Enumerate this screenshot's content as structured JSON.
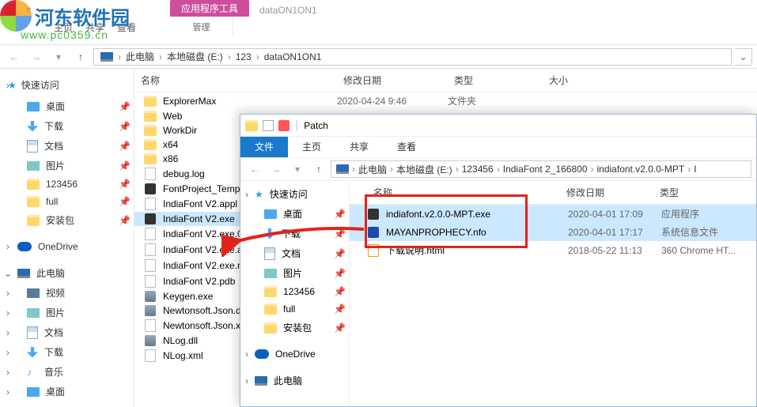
{
  "watermark": {
    "brand": "河东软件园",
    "url": "www.pc0359.cn"
  },
  "back_window": {
    "qat_icons": [
      "folder-icon",
      "props-icon",
      "new-folder-icon"
    ],
    "tabs": {
      "tools_header": "应用程序工具",
      "title": "dataON1ON1",
      "group_label": "管理",
      "left_labels": [
        "主页",
        "共享",
        "查看"
      ]
    },
    "breadcrumb": [
      "此电脑",
      "本地磁盘 (E:)",
      "123",
      "dataON1ON1"
    ],
    "columns": {
      "name": "名称",
      "date": "修改日期",
      "type": "类型",
      "size": "大小"
    },
    "sidebar": {
      "quick": "快速访问",
      "items": [
        {
          "label": "桌面",
          "icon": "desktop-icon",
          "pinned": true
        },
        {
          "label": "下载",
          "icon": "download-icon",
          "pinned": true
        },
        {
          "label": "文档",
          "icon": "document-icon",
          "pinned": true
        },
        {
          "label": "图片",
          "icon": "picture-icon",
          "pinned": true
        },
        {
          "label": "123456",
          "icon": "folder-icon",
          "pinned": true
        },
        {
          "label": "full",
          "icon": "folder-icon",
          "pinned": true
        },
        {
          "label": "安装包",
          "icon": "folder-icon",
          "pinned": true
        }
      ],
      "onedrive": "OneDrive",
      "thispc": "此电脑",
      "pc_items": [
        {
          "label": "视频",
          "icon": "video-icon"
        },
        {
          "label": "图片",
          "icon": "picture-icon"
        },
        {
          "label": "文档",
          "icon": "document-icon"
        },
        {
          "label": "下载",
          "icon": "download-icon"
        },
        {
          "label": "音乐",
          "icon": "music-icon"
        },
        {
          "label": "桌面",
          "icon": "desktop-icon"
        }
      ]
    },
    "files": [
      {
        "name": "ExplorerMax",
        "icon": "folder",
        "date": "2020-04-24 9:46",
        "type": "文件夹"
      },
      {
        "name": "Web",
        "icon": "folder"
      },
      {
        "name": "WorkDir",
        "icon": "folder"
      },
      {
        "name": "x64",
        "icon": "folder"
      },
      {
        "name": "x86",
        "icon": "folder"
      },
      {
        "name": "debug.log",
        "icon": "txt"
      },
      {
        "name": "FontProject_Temp",
        "icon": "app"
      },
      {
        "name": "IndiaFont V2.appl",
        "icon": "txt"
      },
      {
        "name": "IndiaFont V2.exe",
        "icon": "app",
        "selected": true
      },
      {
        "name": "IndiaFont V2.exe.0",
        "icon": "txt"
      },
      {
        "name": "IndiaFont V2.exe.a",
        "icon": "txt"
      },
      {
        "name": "IndiaFont V2.exe.n",
        "icon": "txt"
      },
      {
        "name": "IndiaFont V2.pdb",
        "icon": "txt"
      },
      {
        "name": "Keygen.exe",
        "icon": "exe"
      },
      {
        "name": "Newtonsoft.Json.d",
        "icon": "exe"
      },
      {
        "name": "Newtonsoft.Json.x",
        "icon": "txt"
      },
      {
        "name": "NLog.dll",
        "icon": "exe"
      },
      {
        "name": "NLog.xml",
        "icon": "txt"
      }
    ]
  },
  "front_window": {
    "title": "Patch",
    "tabs": [
      "文件",
      "主页",
      "共享",
      "查看"
    ],
    "breadcrumb": [
      "此电脑",
      "本地磁盘 (E:)",
      "123456",
      "IndiaFont 2_166800",
      "indiafont.v2.0.0-MPT",
      "I"
    ],
    "columns": {
      "name": "名称",
      "date": "修改日期",
      "type": "类型"
    },
    "sidebar": {
      "quick": "快速访问",
      "items": [
        {
          "label": "桌面",
          "icon": "desktop-icon"
        },
        {
          "label": "下载",
          "icon": "download-icon"
        },
        {
          "label": "文档",
          "icon": "document-icon"
        },
        {
          "label": "图片",
          "icon": "picture-icon"
        },
        {
          "label": "123456",
          "icon": "folder-icon"
        },
        {
          "label": "full",
          "icon": "folder-icon"
        },
        {
          "label": "安装包",
          "icon": "folder-icon"
        }
      ],
      "onedrive": "OneDrive",
      "thispc": "此电脑"
    },
    "files": [
      {
        "name": "indiafont.v2.0.0-MPT.exe",
        "icon": "app",
        "date": "2020-04-01 17:09",
        "type": "应用程序",
        "selected": true
      },
      {
        "name": "MAYANPROPHECY.nfo",
        "icon": "nfo",
        "date": "2020-04-01 17:17",
        "type": "系统信息文件",
        "selected": true
      },
      {
        "name": "下载说明.html",
        "icon": "html",
        "date": "2018-05-22 11:13",
        "type": "360 Chrome HT..."
      }
    ]
  }
}
